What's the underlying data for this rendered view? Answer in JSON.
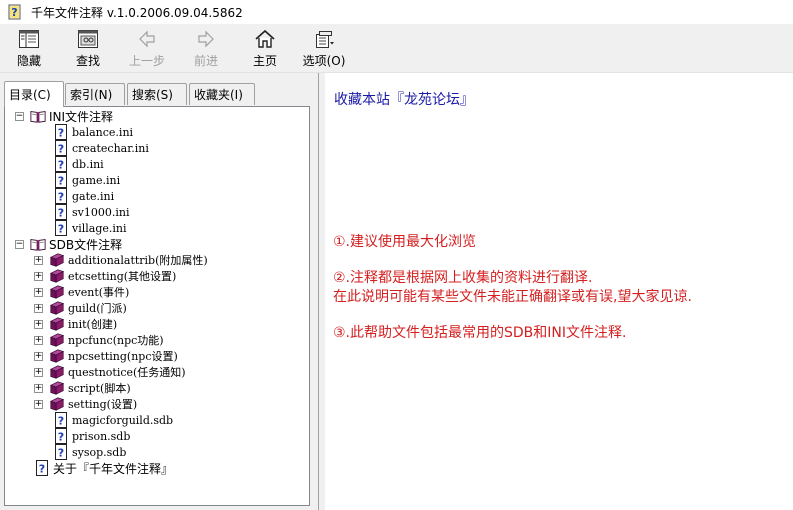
{
  "window": {
    "title": "千年文件注释 v.1.0.2006.09.04.5862",
    "icon": "help-question-icon"
  },
  "toolbar": {
    "buttons": [
      {
        "label": "隐藏",
        "icon": "hide-pane-icon",
        "enabled": true
      },
      {
        "label": "查找",
        "icon": "find-icon",
        "enabled": true
      },
      {
        "label": "上一步",
        "icon": "back-arrow-icon",
        "enabled": false
      },
      {
        "label": "前进",
        "icon": "forward-arrow-icon",
        "enabled": false
      },
      {
        "label": "主页",
        "icon": "home-icon",
        "enabled": true
      },
      {
        "label": "选项(O)",
        "icon": "options-icon",
        "enabled": true
      }
    ]
  },
  "tabs": [
    {
      "label": "目录(C)",
      "active": true
    },
    {
      "label": "索引(N)",
      "active": false
    },
    {
      "label": "搜索(S)",
      "active": false
    },
    {
      "label": "收藏夹(I)",
      "active": false
    }
  ],
  "tree": [
    {
      "label": "INI文件注释",
      "type": "book-open",
      "expander": "⊟",
      "level": 0
    },
    {
      "label": "balance.ini",
      "type": "page",
      "level": 1
    },
    {
      "label": "createchar.ini",
      "type": "page",
      "level": 1
    },
    {
      "label": "db.ini",
      "type": "page",
      "level": 1
    },
    {
      "label": "game.ini",
      "type": "page",
      "level": 1
    },
    {
      "label": "gate.ini",
      "type": "page",
      "level": 1
    },
    {
      "label": "sv1000.ini",
      "type": "page",
      "level": 1
    },
    {
      "label": "village.ini",
      "type": "page",
      "level": 1
    },
    {
      "label": "SDB文件注释",
      "type": "book-open",
      "expander": "⊟",
      "level": 0
    },
    {
      "label": "additionalattrib(附加属性)",
      "type": "book",
      "expander": "⊞",
      "level": 1
    },
    {
      "label": "etcsetting(其他设置)",
      "type": "book",
      "expander": "⊞",
      "level": 1
    },
    {
      "label": "event(事件)",
      "type": "book",
      "expander": "⊞",
      "level": 1
    },
    {
      "label": "guild(门派)",
      "type": "book",
      "expander": "⊞",
      "level": 1
    },
    {
      "label": "init(创建)",
      "type": "book",
      "expander": "⊞",
      "level": 1
    },
    {
      "label": "npcfunc(npc功能)",
      "type": "book",
      "expander": "⊞",
      "level": 1
    },
    {
      "label": "npcsetting(npc设置)",
      "type": "book",
      "expander": "⊞",
      "level": 1
    },
    {
      "label": "questnotice(任务通知)",
      "type": "book",
      "expander": "⊞",
      "level": 1
    },
    {
      "label": "script(脚本)",
      "type": "book",
      "expander": "⊞",
      "level": 1
    },
    {
      "label": "setting(设置)",
      "type": "book",
      "expander": "⊞",
      "level": 1
    },
    {
      "label": "magicforguild.sdb",
      "type": "page",
      "level": 1
    },
    {
      "label": "prison.sdb",
      "type": "page",
      "level": 1
    },
    {
      "label": "sysop.sdb",
      "type": "page",
      "level": 1
    },
    {
      "label": "关于『千年文件注释』",
      "type": "page",
      "level": 0
    }
  ],
  "content": {
    "heading": "收藏本站『龙苑论坛』",
    "notes": [
      "①.建议使用最大化浏览",
      "②.注释都是根据网上收集的资料进行翻译.",
      "在此说明可能有某些文件未能正确翻译或有误,望大家见谅.",
      "③.此帮助文件包括最常用的SDB和INI文件注释."
    ]
  },
  "colors": {
    "heading": "#1a1aa6",
    "notes": "#d42020",
    "book": "#8b1a6b"
  }
}
